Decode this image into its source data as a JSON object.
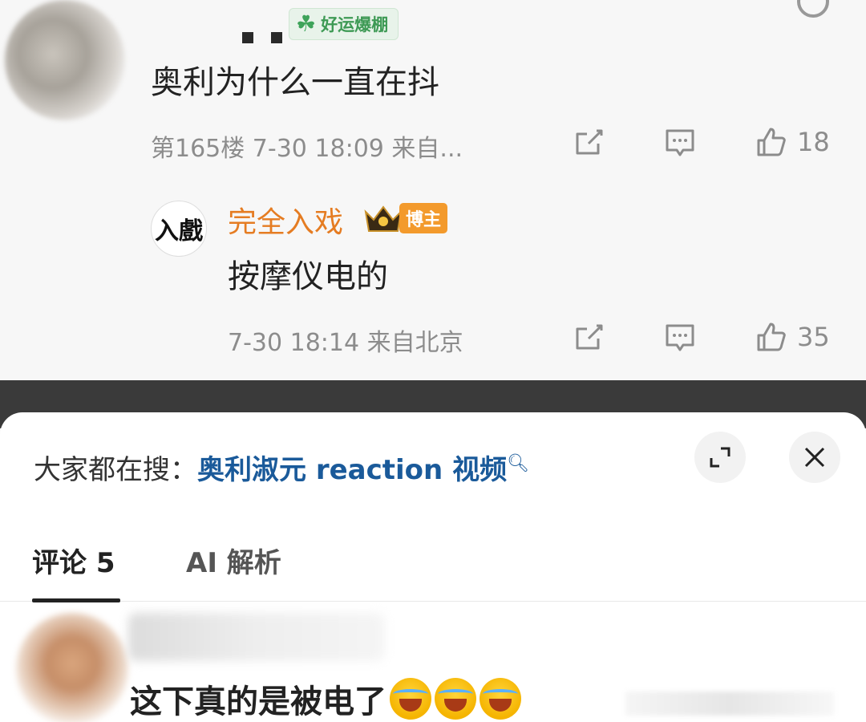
{
  "top_comment": {
    "badge": "好运爆棚",
    "text": "奥利为什么一直在抖",
    "meta": "第165楼  7-30 18:09  来自...",
    "likes": "18"
  },
  "reply": {
    "avatar_text": "入戲",
    "name": "完全入戏",
    "tag": "博主",
    "text": "按摩仪电的",
    "meta": "7-30 18:14  来自北京",
    "likes": "35"
  },
  "sheet": {
    "hot_prefix": "大家都在搜：",
    "hot_keyword": "奥利淑元 reaction 视频",
    "tabs": [
      {
        "label": "评论 5"
      },
      {
        "label": "AI 解析"
      }
    ]
  },
  "comment2": {
    "text": "这下真的是被电了"
  },
  "colors": {
    "accent_blue": "#1a5a9a",
    "blogger_orange": "#e57c22",
    "luck_green": "#3e9a55"
  }
}
